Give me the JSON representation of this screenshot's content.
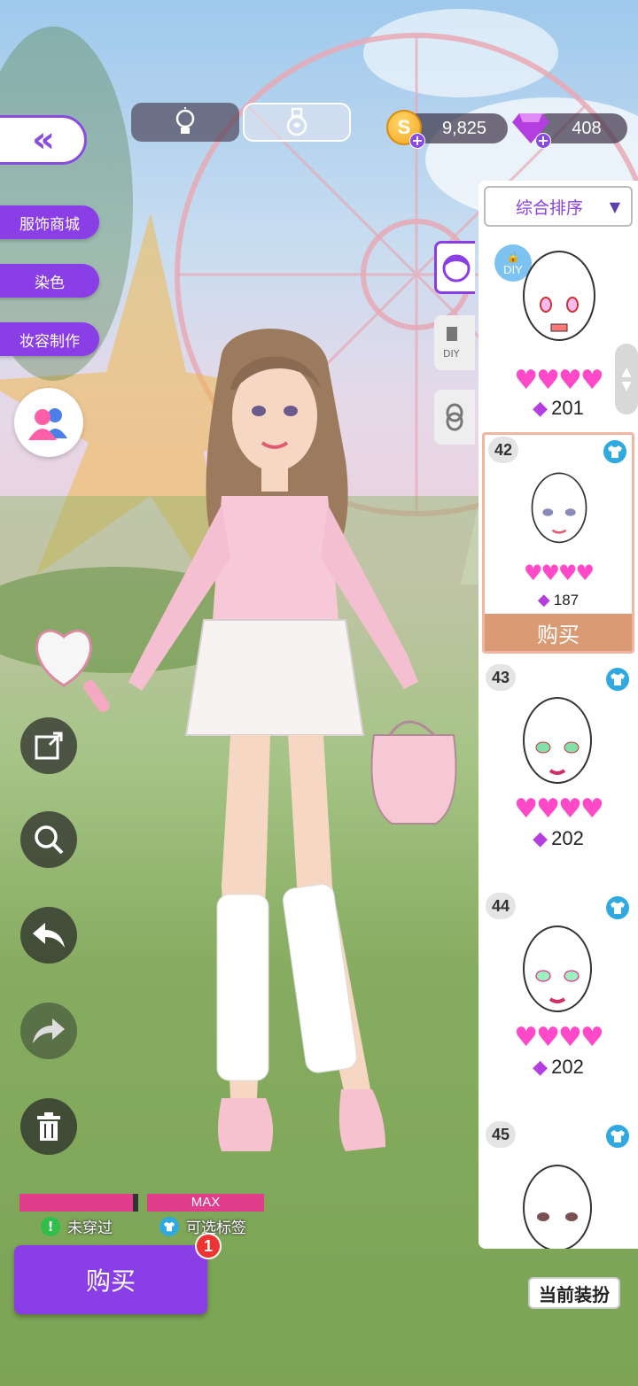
{
  "toolbar": {
    "back_icon": "double-chevron-left-icon",
    "hint_icon": "lightbulb-icon",
    "potion_icon": "potion-icon",
    "coins": "9,825",
    "gems": "408"
  },
  "left_menu": {
    "items": [
      {
        "label": "服饰商城"
      },
      {
        "label": "染色"
      },
      {
        "label": "妆容制作"
      }
    ],
    "friends_icon": "friends-icon"
  },
  "tools": [
    "share-icon",
    "zoom-icon",
    "undo-icon",
    "redo-icon",
    "trash-icon"
  ],
  "panel": {
    "sort_label": "综合排序",
    "diy_label": "DIY",
    "side_tabs": [
      "face-icon",
      "makeup-diy-icon",
      "ring-icon"
    ],
    "items": [
      {
        "num": "",
        "hearts": "♥♥♥♥",
        "price": "201"
      },
      {
        "num": "42",
        "hearts": "♥♥♥♥",
        "price": "187",
        "buy": "购买"
      },
      {
        "num": "43",
        "hearts": "♥♥♥♥",
        "price": "202"
      },
      {
        "num": "44",
        "hearts": "♥♥♥♥",
        "price": "202"
      },
      {
        "num": "45"
      }
    ]
  },
  "status": {
    "max_label": "MAX",
    "not_worn": "未穿过",
    "optional_tag": "可选标签"
  },
  "bottom": {
    "buy_label": "购买",
    "buy_badge": "1",
    "current_outfit": "当前装扮"
  },
  "colors": {
    "accent": "#8a3fe6",
    "heart": "#ff49c8",
    "buy_strip": "#d99a74"
  }
}
